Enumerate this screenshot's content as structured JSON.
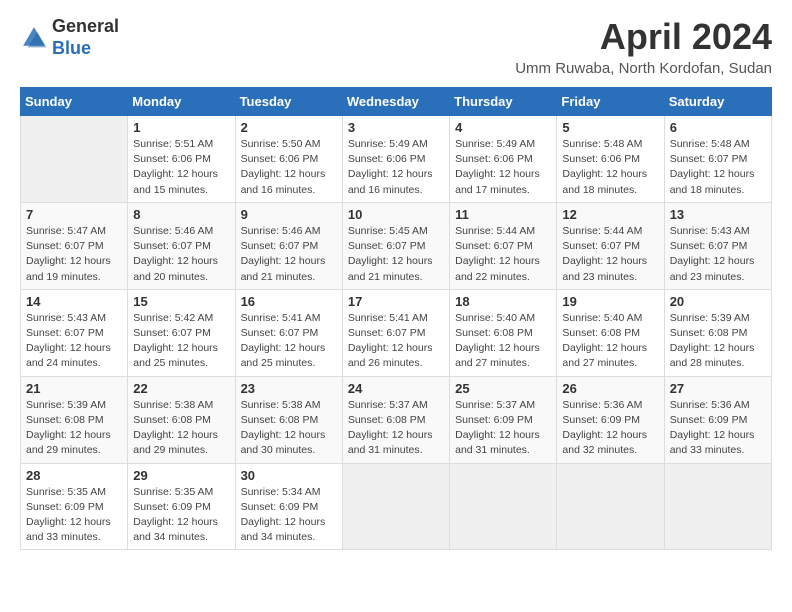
{
  "header": {
    "logo_general": "General",
    "logo_blue": "Blue",
    "month_title": "April 2024",
    "location": "Umm Ruwaba, North Kordofan, Sudan"
  },
  "days_of_week": [
    "Sunday",
    "Monday",
    "Tuesday",
    "Wednesday",
    "Thursday",
    "Friday",
    "Saturday"
  ],
  "weeks": [
    [
      {
        "num": "",
        "content": ""
      },
      {
        "num": "1",
        "content": "Sunrise: 5:51 AM\nSunset: 6:06 PM\nDaylight: 12 hours\nand 15 minutes."
      },
      {
        "num": "2",
        "content": "Sunrise: 5:50 AM\nSunset: 6:06 PM\nDaylight: 12 hours\nand 16 minutes."
      },
      {
        "num": "3",
        "content": "Sunrise: 5:49 AM\nSunset: 6:06 PM\nDaylight: 12 hours\nand 16 minutes."
      },
      {
        "num": "4",
        "content": "Sunrise: 5:49 AM\nSunset: 6:06 PM\nDaylight: 12 hours\nand 17 minutes."
      },
      {
        "num": "5",
        "content": "Sunrise: 5:48 AM\nSunset: 6:06 PM\nDaylight: 12 hours\nand 18 minutes."
      },
      {
        "num": "6",
        "content": "Sunrise: 5:48 AM\nSunset: 6:07 PM\nDaylight: 12 hours\nand 18 minutes."
      }
    ],
    [
      {
        "num": "7",
        "content": "Sunrise: 5:47 AM\nSunset: 6:07 PM\nDaylight: 12 hours\nand 19 minutes."
      },
      {
        "num": "8",
        "content": "Sunrise: 5:46 AM\nSunset: 6:07 PM\nDaylight: 12 hours\nand 20 minutes."
      },
      {
        "num": "9",
        "content": "Sunrise: 5:46 AM\nSunset: 6:07 PM\nDaylight: 12 hours\nand 21 minutes."
      },
      {
        "num": "10",
        "content": "Sunrise: 5:45 AM\nSunset: 6:07 PM\nDaylight: 12 hours\nand 21 minutes."
      },
      {
        "num": "11",
        "content": "Sunrise: 5:44 AM\nSunset: 6:07 PM\nDaylight: 12 hours\nand 22 minutes."
      },
      {
        "num": "12",
        "content": "Sunrise: 5:44 AM\nSunset: 6:07 PM\nDaylight: 12 hours\nand 23 minutes."
      },
      {
        "num": "13",
        "content": "Sunrise: 5:43 AM\nSunset: 6:07 PM\nDaylight: 12 hours\nand 23 minutes."
      }
    ],
    [
      {
        "num": "14",
        "content": "Sunrise: 5:43 AM\nSunset: 6:07 PM\nDaylight: 12 hours\nand 24 minutes."
      },
      {
        "num": "15",
        "content": "Sunrise: 5:42 AM\nSunset: 6:07 PM\nDaylight: 12 hours\nand 25 minutes."
      },
      {
        "num": "16",
        "content": "Sunrise: 5:41 AM\nSunset: 6:07 PM\nDaylight: 12 hours\nand 25 minutes."
      },
      {
        "num": "17",
        "content": "Sunrise: 5:41 AM\nSunset: 6:07 PM\nDaylight: 12 hours\nand 26 minutes."
      },
      {
        "num": "18",
        "content": "Sunrise: 5:40 AM\nSunset: 6:08 PM\nDaylight: 12 hours\nand 27 minutes."
      },
      {
        "num": "19",
        "content": "Sunrise: 5:40 AM\nSunset: 6:08 PM\nDaylight: 12 hours\nand 27 minutes."
      },
      {
        "num": "20",
        "content": "Sunrise: 5:39 AM\nSunset: 6:08 PM\nDaylight: 12 hours\nand 28 minutes."
      }
    ],
    [
      {
        "num": "21",
        "content": "Sunrise: 5:39 AM\nSunset: 6:08 PM\nDaylight: 12 hours\nand 29 minutes."
      },
      {
        "num": "22",
        "content": "Sunrise: 5:38 AM\nSunset: 6:08 PM\nDaylight: 12 hours\nand 29 minutes."
      },
      {
        "num": "23",
        "content": "Sunrise: 5:38 AM\nSunset: 6:08 PM\nDaylight: 12 hours\nand 30 minutes."
      },
      {
        "num": "24",
        "content": "Sunrise: 5:37 AM\nSunset: 6:08 PM\nDaylight: 12 hours\nand 31 minutes."
      },
      {
        "num": "25",
        "content": "Sunrise: 5:37 AM\nSunset: 6:09 PM\nDaylight: 12 hours\nand 31 minutes."
      },
      {
        "num": "26",
        "content": "Sunrise: 5:36 AM\nSunset: 6:09 PM\nDaylight: 12 hours\nand 32 minutes."
      },
      {
        "num": "27",
        "content": "Sunrise: 5:36 AM\nSunset: 6:09 PM\nDaylight: 12 hours\nand 33 minutes."
      }
    ],
    [
      {
        "num": "28",
        "content": "Sunrise: 5:35 AM\nSunset: 6:09 PM\nDaylight: 12 hours\nand 33 minutes."
      },
      {
        "num": "29",
        "content": "Sunrise: 5:35 AM\nSunset: 6:09 PM\nDaylight: 12 hours\nand 34 minutes."
      },
      {
        "num": "30",
        "content": "Sunrise: 5:34 AM\nSunset: 6:09 PM\nDaylight: 12 hours\nand 34 minutes."
      },
      {
        "num": "",
        "content": ""
      },
      {
        "num": "",
        "content": ""
      },
      {
        "num": "",
        "content": ""
      },
      {
        "num": "",
        "content": ""
      }
    ]
  ]
}
